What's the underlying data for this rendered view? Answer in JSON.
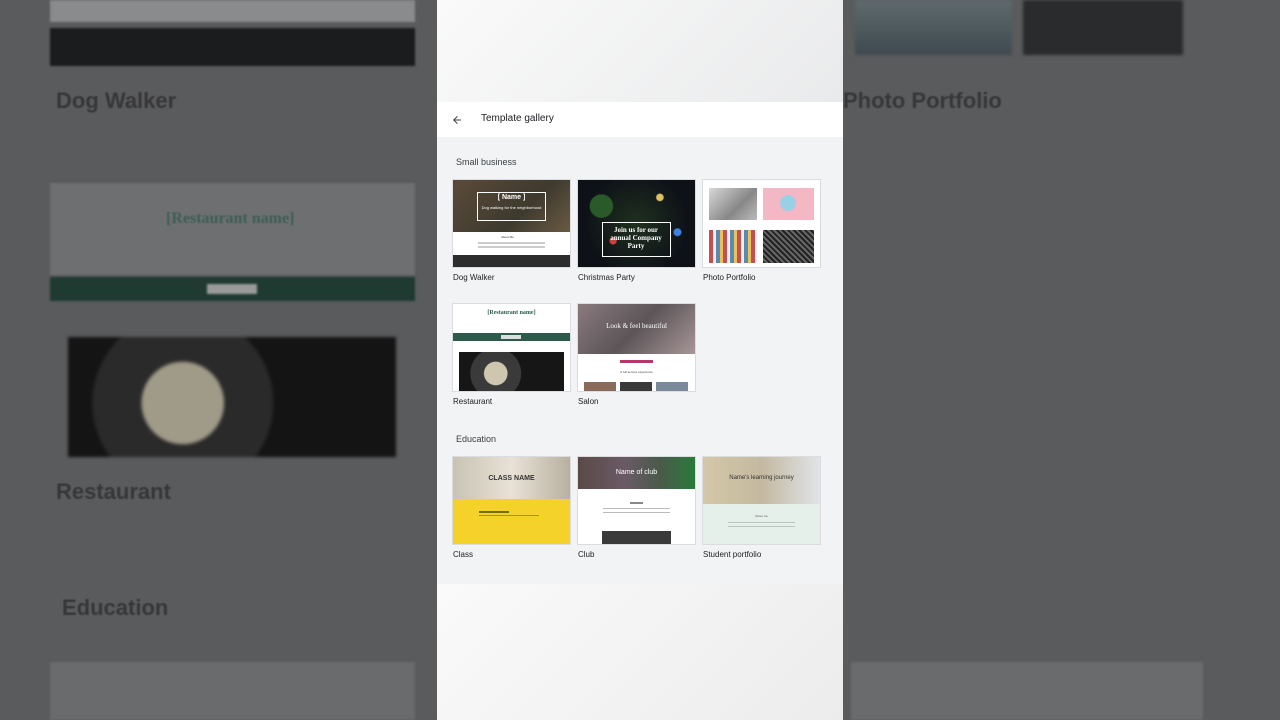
{
  "header": {
    "title": "Template gallery",
    "back_icon": "arrow-back-icon"
  },
  "sections": [
    {
      "title": "Small business",
      "templates": [
        {
          "label": "Dog Walker",
          "thumb_text": [
            "[ Name ]",
            "Dog walking for the neighborhood",
            "About Me"
          ]
        },
        {
          "label": "Christmas Party",
          "thumb_text": [
            "Join us for our annual Company Party"
          ]
        },
        {
          "label": "Photo Portfolio"
        },
        {
          "label": "Restaurant",
          "thumb_text": [
            "[Restaurant name]"
          ]
        },
        {
          "label": "Salon",
          "thumb_text": [
            "Look & feel beautiful",
            "A full-service experience"
          ]
        }
      ]
    },
    {
      "title": "Education",
      "templates": [
        {
          "label": "Class",
          "thumb_text": [
            "CLASS NAME"
          ]
        },
        {
          "label": "Club",
          "thumb_text": [
            "Name of club"
          ]
        },
        {
          "label": "Student portfolio",
          "thumb_text": [
            "Name's learning journey",
            "About me"
          ]
        }
      ]
    }
  ],
  "background": {
    "left_labels": [
      "Dog Walker",
      "Restaurant",
      "Education"
    ],
    "left_restaurant_text": "[Restaurant name]",
    "right_labels": [
      "Photo Portfolio"
    ]
  },
  "colors": {
    "accent_green": "#2e5a4c",
    "class_yellow": "#f5d229",
    "student_mint": "#e6f0ea"
  }
}
